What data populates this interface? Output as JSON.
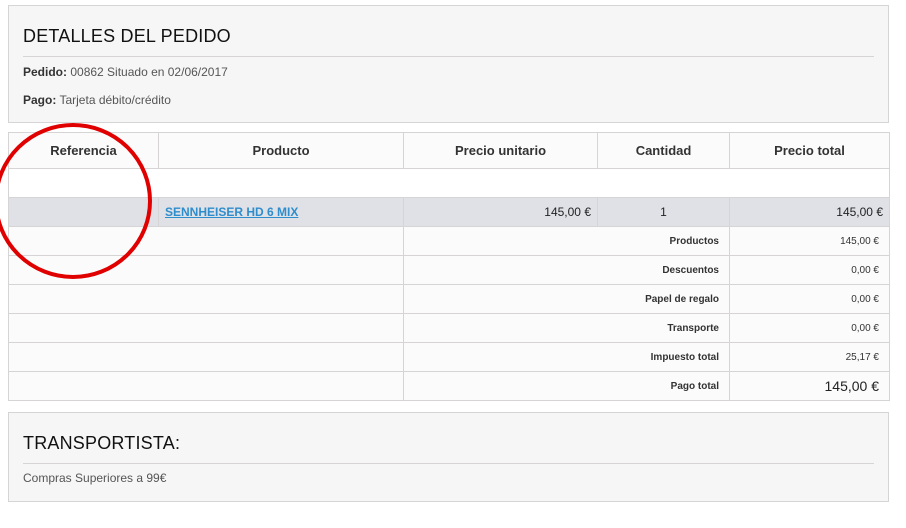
{
  "order_panel": {
    "title": "DETALLES DEL PEDIDO",
    "order_label": "Pedido:",
    "order_value": "00862 Situado en 02/06/2017",
    "payment_label": "Pago:",
    "payment_value": "Tarjeta débito/crédito"
  },
  "table": {
    "headers": [
      "Referencia",
      "Producto",
      "Precio unitario",
      "Cantidad",
      "Precio total"
    ],
    "item": {
      "reference": "",
      "product": "SENNHEISER HD 6 MIX",
      "unit_price": "145,00 €",
      "quantity": "1",
      "total_price": "145,00 €"
    },
    "totals": [
      {
        "label": "Productos",
        "value": "145,00 €"
      },
      {
        "label": "Descuentos",
        "value": "0,00 €"
      },
      {
        "label": "Papel de regalo",
        "value": "0,00 €"
      },
      {
        "label": "Transporte",
        "value": "0,00 €"
      },
      {
        "label": "Impuesto total",
        "value": "25,17 €"
      },
      {
        "label": "Pago total",
        "value": "145,00 €"
      }
    ]
  },
  "carrier_panel": {
    "title": "TRANSPORTISTA:",
    "text": "Compras Superiores a 99€"
  },
  "annotation": {
    "color": "#e00000"
  }
}
